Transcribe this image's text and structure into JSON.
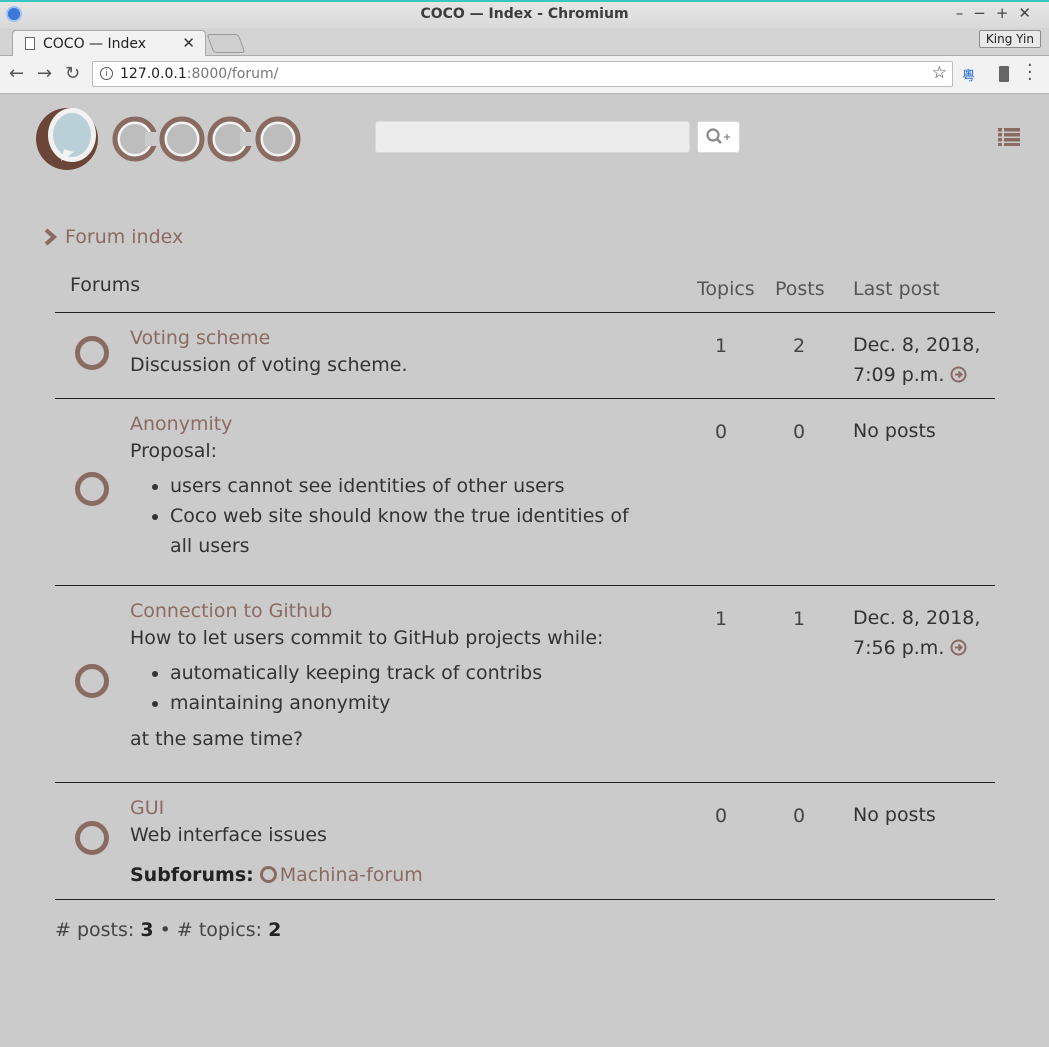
{
  "browser": {
    "window_title": "COCO — Index - Chromium",
    "tab_title": "COCO — Index",
    "profile": "King Yin",
    "url_host": "127.0.0.1",
    "url_rest": ":8000/forum/",
    "ext_label": "粵"
  },
  "header": {
    "search_placeholder": "",
    "accent_color": "#8a6b62"
  },
  "breadcrumb": {
    "label": "Forum index"
  },
  "table": {
    "col_forums": "Forums",
    "col_topics": "Topics",
    "col_posts": "Posts",
    "col_last": "Last post"
  },
  "forums": [
    {
      "name": "Voting scheme",
      "desc": "Discussion of voting scheme.",
      "topics": "1",
      "posts": "2",
      "last_line1": "Dec. 8, 2018,",
      "last_line2": "7:09 p.m."
    },
    {
      "name": "Anonymity",
      "desc": "Proposal:",
      "bullets": [
        "users cannot see identities of other users",
        "Coco web site should know the true identities of all users"
      ],
      "topics": "0",
      "posts": "0",
      "last": "No posts"
    },
    {
      "name": "Connection to Github",
      "desc": "How to let users commit to GitHub projects while:",
      "bullets": [
        "automatically keeping track of contribs",
        "maintaining anonymity"
      ],
      "after": "at the same time?",
      "topics": "1",
      "posts": "1",
      "last_line1": "Dec. 8, 2018,",
      "last_line2": "7:56 p.m."
    },
    {
      "name": "GUI",
      "desc": "Web interface issues",
      "subforums_label": "Subforums:",
      "subforum": "Machina-forum",
      "topics": "0",
      "posts": "0",
      "last": "No posts"
    }
  ],
  "stats": {
    "posts_label": "# posts:",
    "posts": "3",
    "sep": "•",
    "topics_label": "# topics:",
    "topics": "2"
  }
}
